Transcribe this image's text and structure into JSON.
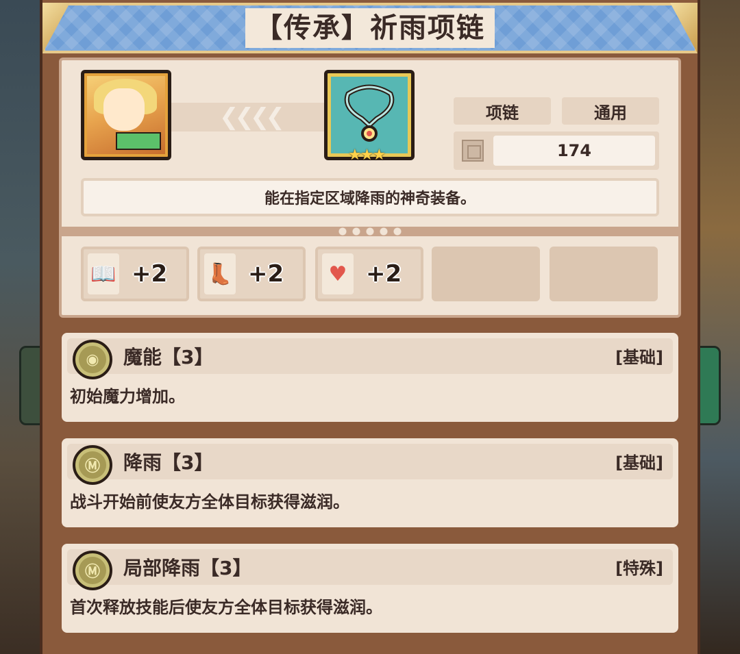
{
  "header": {
    "title": "【传承】祈雨项链"
  },
  "item": {
    "type_tag": "项链",
    "class_tag": "通用",
    "power": "174",
    "description": "能在指定区域降雨的神奇装备。",
    "stars": "★★★"
  },
  "stats": [
    {
      "icon": "book-icon",
      "glyph": "📖",
      "value": "+2"
    },
    {
      "icon": "boot-icon",
      "glyph": "👢",
      "value": "+2"
    },
    {
      "icon": "heart-icon",
      "glyph": "♥",
      "value": "+2"
    }
  ],
  "traits": [
    {
      "name": "魔能【3】",
      "category": "[基础]",
      "description": "初始魔力增加。",
      "medal": "◉"
    },
    {
      "name": "降雨【3】",
      "category": "[基础]",
      "description": "战斗开始前使友方全体目标获得滋润。",
      "medal": "Ⓜ"
    },
    {
      "name": "局部降雨【3】",
      "category": "[特殊]",
      "description": "首次释放技能后使友方全体目标获得滋润。",
      "medal": "Ⓜ"
    }
  ],
  "colors": {
    "header_blue": "#6f9ed6",
    "panel": "#f1e4d6",
    "frame": "#8a5a3c",
    "text": "#3a2a26"
  }
}
